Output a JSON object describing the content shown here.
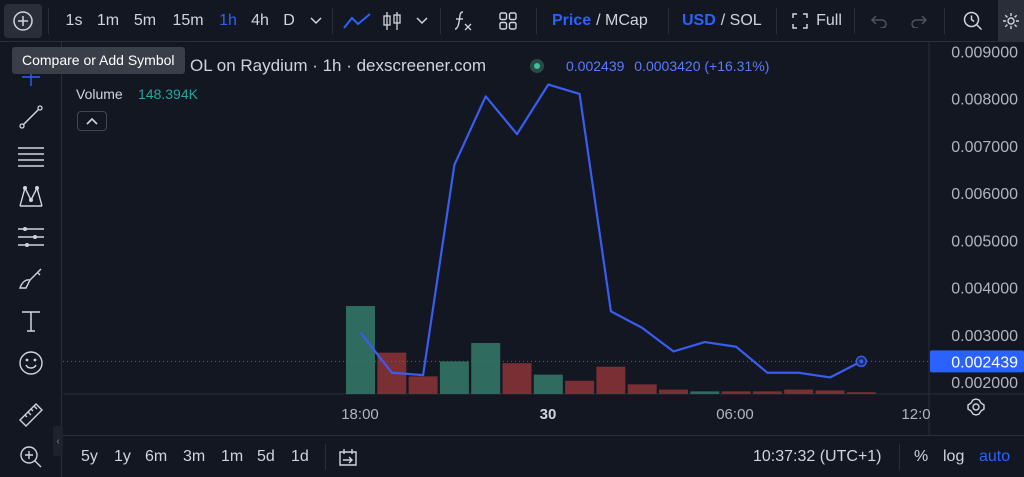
{
  "toolbar": {
    "intervals": [
      "1s",
      "1m",
      "5m",
      "15m",
      "1h",
      "4h",
      "D"
    ],
    "active_interval": "1h",
    "price_label": "Price",
    "mcap_label": "/ MCap",
    "usd_label": "USD",
    "sol_label": "/ SOL",
    "full_label": "Full"
  },
  "tooltip": {
    "text": "Compare or Add Symbol"
  },
  "legend": {
    "title": "OL on Raydium · 1h · dexscreener.com",
    "last_price": "0.002439",
    "change": "0.0003420",
    "change_pct": "(+16.31%)",
    "volume_label": "Volume",
    "volume_value": "148.394K"
  },
  "price_axis": {
    "ticks": [
      "0.009000",
      "0.008000",
      "0.007000",
      "0.006000",
      "0.005000",
      "0.004000",
      "0.003000",
      "0.002000"
    ],
    "current_price_label": "0.002439"
  },
  "time_axis": {
    "ticks": [
      "18:00",
      "30",
      "06:00",
      "12:0"
    ]
  },
  "bottom": {
    "ranges": [
      "5y",
      "1y",
      "6m",
      "3m",
      "1m",
      "5d",
      "1d"
    ],
    "clock": "10:37:32 (UTC+1)",
    "percent_label": "%",
    "log_label": "log",
    "auto_label": "auto"
  },
  "colors": {
    "line": "#3a5cf0",
    "volume_up": "#2f6b5e",
    "volume_down": "#7a2f35",
    "accent": "#2962ff",
    "price_tag": "#2962ff"
  },
  "chart_data": {
    "type": "line",
    "price_series": [
      {
        "x": "17:00",
        "y": 0.00305
      },
      {
        "x": "18:00",
        "y": 0.0022
      },
      {
        "x": "19:00",
        "y": 0.00215
      },
      {
        "x": "20:00",
        "y": 0.0066
      },
      {
        "x": "21:00",
        "y": 0.00805
      },
      {
        "x": "22:00",
        "y": 0.00725
      },
      {
        "x": "23:00",
        "y": 0.0083
      },
      {
        "x": "00:00",
        "y": 0.0081
      },
      {
        "x": "01:00",
        "y": 0.0035
      },
      {
        "x": "02:00",
        "y": 0.00315
      },
      {
        "x": "03:00",
        "y": 0.00265
      },
      {
        "x": "04:00",
        "y": 0.00285
      },
      {
        "x": "05:00",
        "y": 0.00275
      },
      {
        "x": "06:00",
        "y": 0.0022
      },
      {
        "x": "07:00",
        "y": 0.0022
      },
      {
        "x": "08:00",
        "y": 0.0021
      },
      {
        "x": "09:00",
        "y": 0.00244
      }
    ],
    "volume_series": [
      {
        "x": "17:00",
        "v": 1.0,
        "dir": "up"
      },
      {
        "x": "18:00",
        "v": 0.47,
        "dir": "down"
      },
      {
        "x": "19:00",
        "v": 0.2,
        "dir": "down"
      },
      {
        "x": "20:00",
        "v": 0.37,
        "dir": "up"
      },
      {
        "x": "21:00",
        "v": 0.58,
        "dir": "up"
      },
      {
        "x": "22:00",
        "v": 0.35,
        "dir": "down"
      },
      {
        "x": "23:00",
        "v": 0.22,
        "dir": "up"
      },
      {
        "x": "00:00",
        "v": 0.15,
        "dir": "down"
      },
      {
        "x": "01:00",
        "v": 0.31,
        "dir": "down"
      },
      {
        "x": "02:00",
        "v": 0.11,
        "dir": "down"
      },
      {
        "x": "03:00",
        "v": 0.05,
        "dir": "down"
      },
      {
        "x": "04:00",
        "v": 0.03,
        "dir": "up"
      },
      {
        "x": "05:00",
        "v": 0.03,
        "dir": "down"
      },
      {
        "x": "06:00",
        "v": 0.03,
        "dir": "down"
      },
      {
        "x": "07:00",
        "v": 0.05,
        "dir": "down"
      },
      {
        "x": "08:00",
        "v": 0.04,
        "dir": "down"
      },
      {
        "x": "09:00",
        "v": 0.02,
        "dir": "down"
      }
    ],
    "ylim": [
      0.00175,
      0.0092
    ],
    "grid": false
  }
}
